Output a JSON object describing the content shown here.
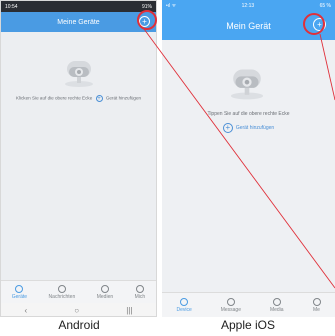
{
  "colors": {
    "header_blue": "#4a9be3",
    "ios_blue": "#4aa6f2",
    "highlight_red": "#e0303a",
    "link_blue": "#4a8fd6"
  },
  "android": {
    "statusbar": {
      "time": "10:54",
      "right": "91%"
    },
    "title": "Meine Geräte",
    "add_icon": "plus-circle-icon",
    "hint_before": "Klicken Sie auf die obere rechte Ecke",
    "hint_after": "Gerät hinzufügen",
    "tabs": [
      {
        "label": "Geräte",
        "icon": "devices-icon",
        "active": true
      },
      {
        "label": "Nachrichten",
        "icon": "message-icon",
        "active": false
      },
      {
        "label": "Medien",
        "icon": "media-icon",
        "active": false
      },
      {
        "label": "Mich",
        "icon": "me-icon",
        "active": false
      }
    ],
    "nav": {
      "back": "‹",
      "home": "○",
      "recent": "|||"
    },
    "caption": "Android"
  },
  "ios": {
    "statusbar": {
      "left": "•ıl ᯤ",
      "time": "12:13",
      "right": "65 %"
    },
    "title": "Mein Gerät",
    "add_icon": "plus-circle-icon",
    "hint": "Tippen Sie auf die obere rechte Ecke",
    "add_label": "Gerät hinzufügen",
    "tabs": [
      {
        "label": "Device",
        "icon": "devices-icon",
        "active": true
      },
      {
        "label": "Message",
        "icon": "message-icon",
        "active": false
      },
      {
        "label": "Media",
        "icon": "media-icon",
        "active": false
      },
      {
        "label": "Me",
        "icon": "me-icon",
        "active": false
      }
    ],
    "caption": "Apple iOS"
  }
}
